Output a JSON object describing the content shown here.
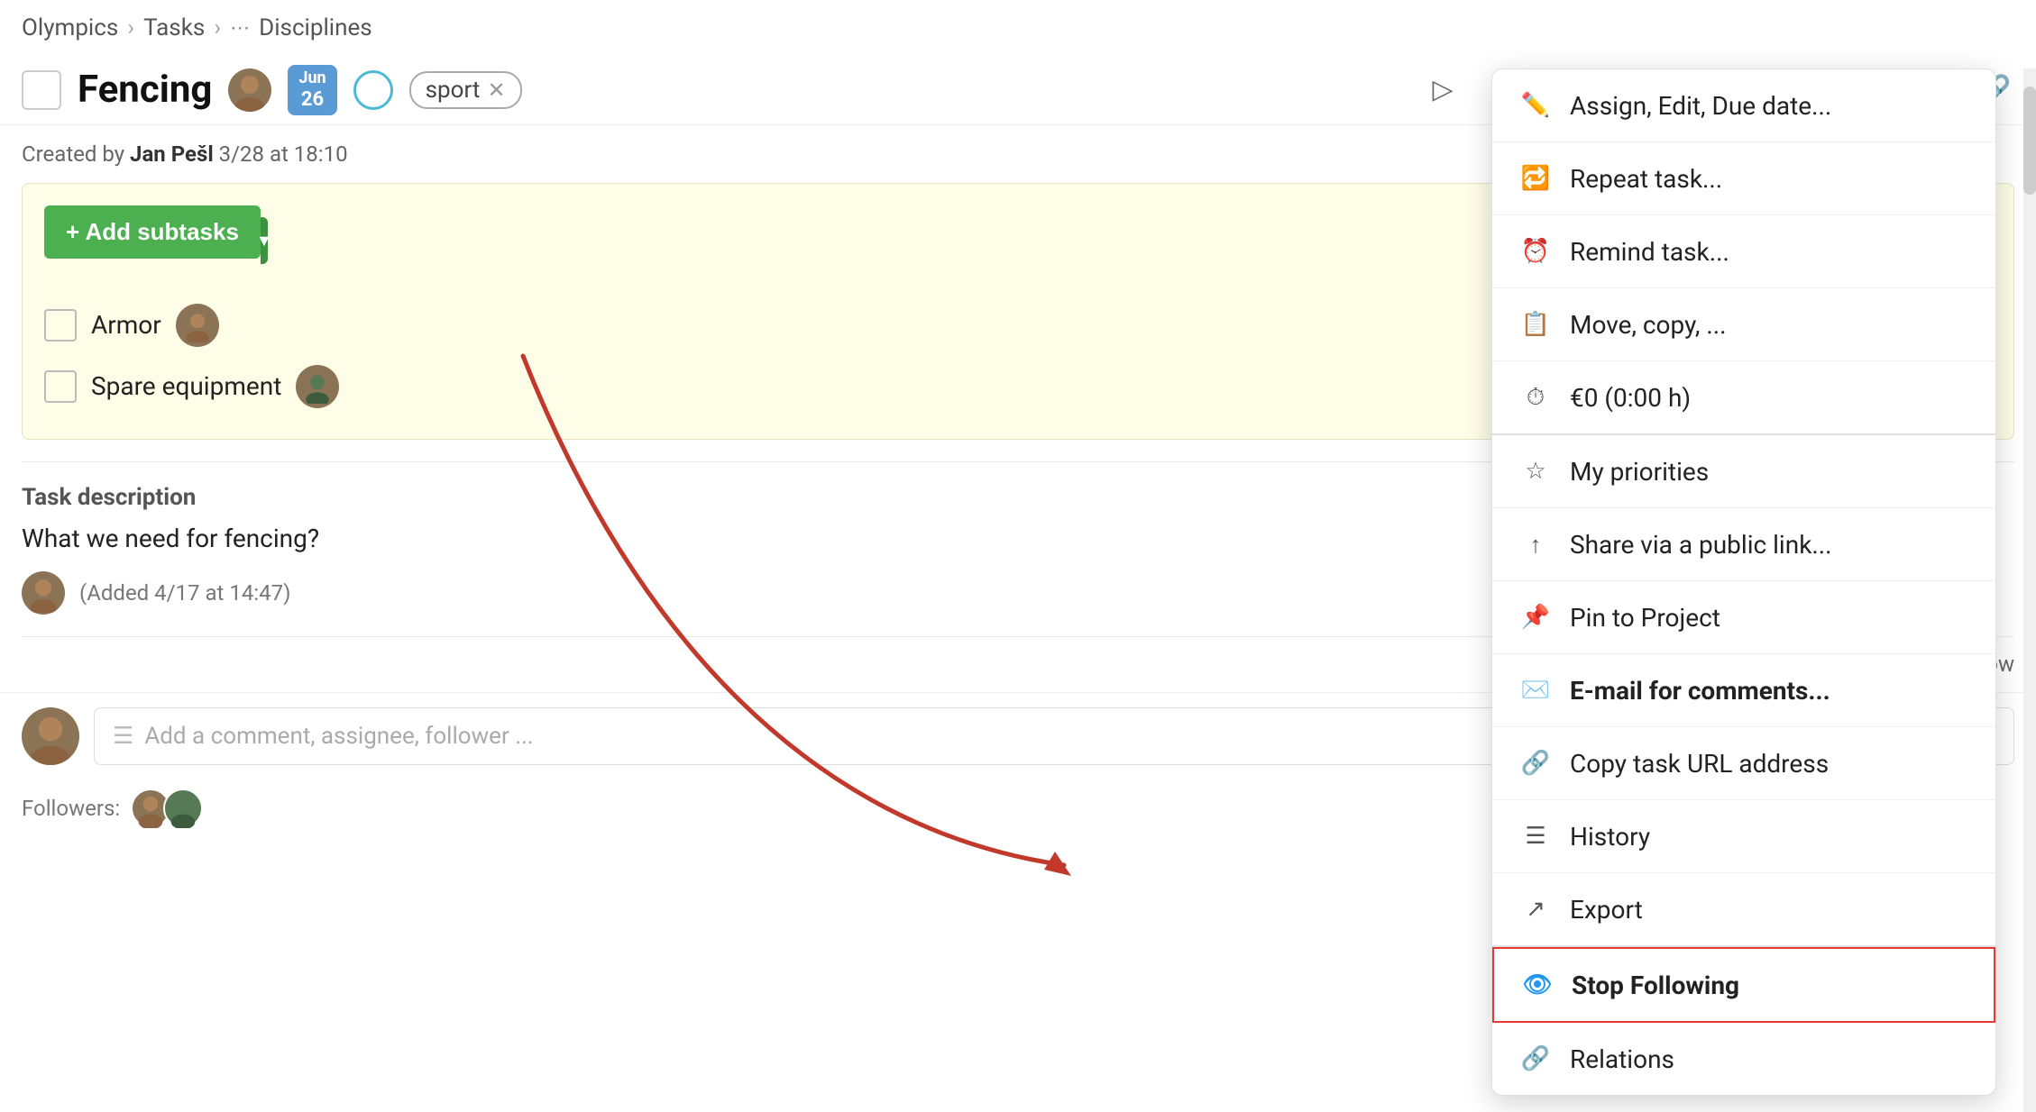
{
  "breadcrumb": {
    "items": [
      "Olympics",
      "Tasks",
      "Disciplines"
    ]
  },
  "header": {
    "title": "Fencing",
    "date_month": "Jun",
    "date_day": "26",
    "tag": "sport",
    "three_dots_label": "⋯"
  },
  "meta": {
    "created_by": "Jan Pešl",
    "created_at": "3/28 at 18:10"
  },
  "subtasks": {
    "add_label": "+ Add subtasks",
    "items": [
      {
        "name": "Armor"
      },
      {
        "name": "Spare equipment"
      }
    ]
  },
  "description": {
    "label": "Task description",
    "text": "What we need for fencing?",
    "comment_added": "(Added 4/17 at 14:47)"
  },
  "latest": "↕ Latest dow",
  "comment_placeholder": "Add a comment, assignee, follower ...",
  "followers_label": "Followers:",
  "menu": {
    "items": [
      {
        "icon": "✏️",
        "label": "Assign, Edit, Due date...",
        "bold": false,
        "highlighted": false
      },
      {
        "icon": "🔁",
        "label": "Repeat task...",
        "bold": false,
        "highlighted": false
      },
      {
        "icon": "🔔",
        "label": "Remind task...",
        "bold": false,
        "highlighted": false
      },
      {
        "icon": "📋",
        "label": "Move, copy, ...",
        "bold": false,
        "highlighted": false
      },
      {
        "icon": "⏱️",
        "label": "€0 (0:00 h)",
        "bold": false,
        "highlighted": false
      },
      {
        "icon": "⭐",
        "label": "My priorities",
        "bold": false,
        "highlighted": false
      },
      {
        "icon": "↑",
        "label": "Share via a public link...",
        "bold": false,
        "highlighted": false
      },
      {
        "icon": "📌",
        "label": "Pin to Project",
        "bold": false,
        "highlighted": false
      },
      {
        "icon": "✉️",
        "label": "E-mail for comments...",
        "bold": true,
        "highlighted": false
      },
      {
        "icon": "🔗",
        "label": "Copy task URL address",
        "bold": false,
        "highlighted": false
      },
      {
        "icon": "☰",
        "label": "History",
        "bold": false,
        "highlighted": false
      },
      {
        "icon": "↗️",
        "label": "Export",
        "bold": false,
        "highlighted": false
      },
      {
        "icon": "👁️",
        "label": "Stop Following",
        "bold": true,
        "highlighted": true
      },
      {
        "icon": "🔗",
        "label": "Relations",
        "bold": false,
        "highlighted": false
      }
    ]
  }
}
